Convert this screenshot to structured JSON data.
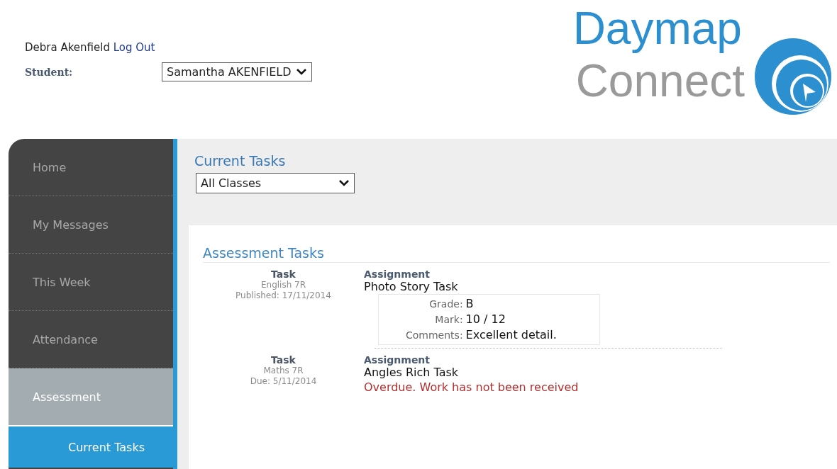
{
  "header": {
    "user_name": "Debra Akenfield",
    "logout_link": "Log Out",
    "student_label": "Student:",
    "student_select": "Samantha AKENFIELD",
    "logo_line_1": "Daymap",
    "logo_line_2": "Connect"
  },
  "sidebar": {
    "items": [
      {
        "label": "Home",
        "selected": false
      },
      {
        "label": "My Messages",
        "selected": false
      },
      {
        "label": "This Week",
        "selected": false
      },
      {
        "label": "Attendance",
        "selected": false
      },
      {
        "label": "Assessment",
        "selected": true,
        "children": [
          {
            "label": "Current Tasks",
            "selected": true
          }
        ]
      }
    ]
  },
  "page": {
    "title": "Current Tasks",
    "class_filter": "All Classes"
  },
  "assessment": {
    "heading": "Assessment Tasks",
    "tasks": [
      {
        "task_label": "Task",
        "class": "English 7R",
        "date": "Published: 17/11/2014",
        "assignment_label": "Assignment",
        "title": "Photo Story Task",
        "kind": "marked",
        "results": [
          {
            "label": "Grade:",
            "value": "B"
          },
          {
            "label": "Mark:",
            "value": "10 / 12"
          },
          {
            "label": "Comments:",
            "value": "Excellent detail."
          }
        ]
      },
      {
        "task_label": "Task",
        "class": "Maths 7R",
        "date": "Due: 5/11/2014",
        "assignment_label": "Assignment",
        "title": "Angles Rich Task",
        "kind": "overdue",
        "status": "Overdue. Work has not been received"
      }
    ]
  }
}
